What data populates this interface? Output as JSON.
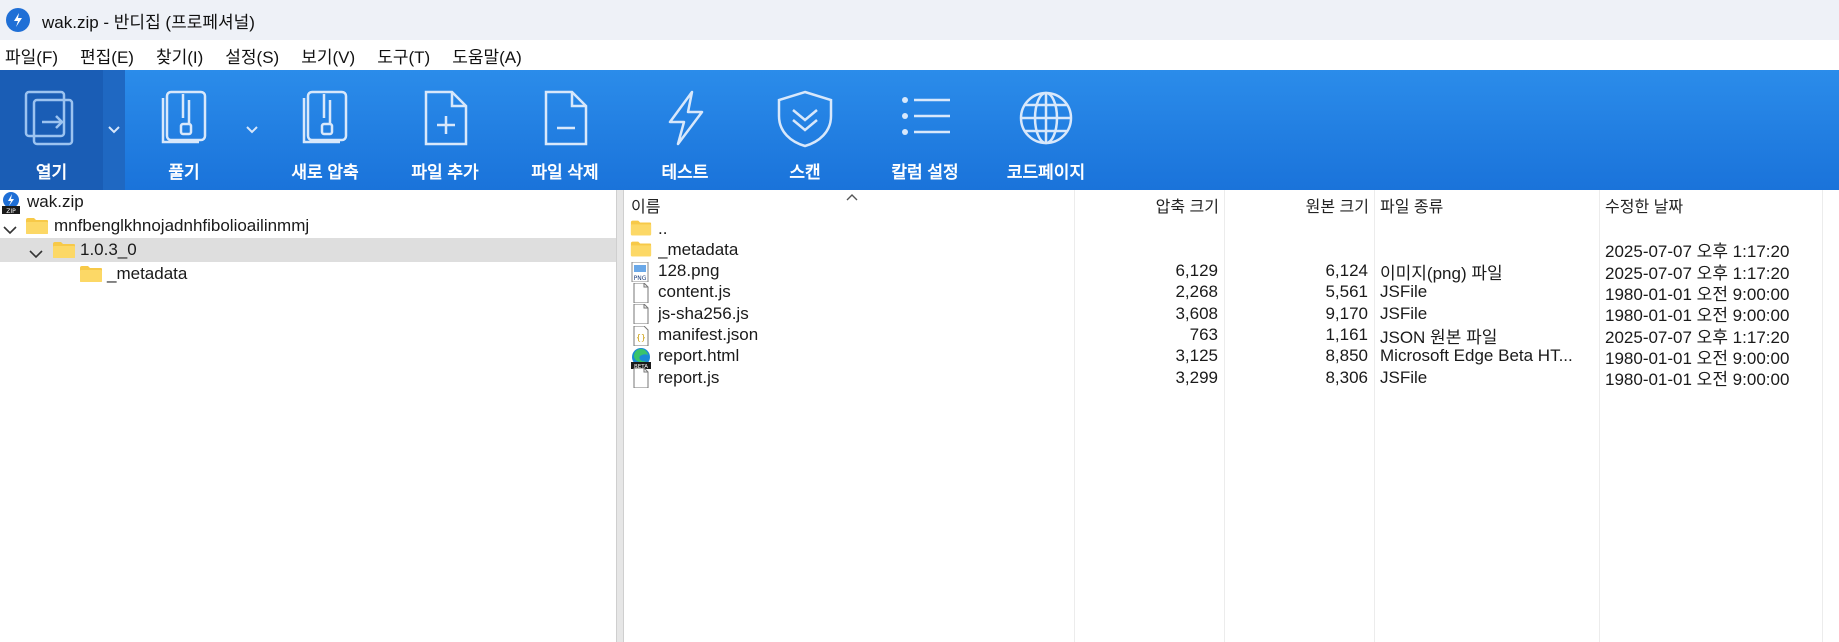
{
  "window": {
    "title": "wak.zip - 반디집 (프로페셔널)"
  },
  "menu": [
    {
      "label": "파일(F)"
    },
    {
      "label": "편집(E)"
    },
    {
      "label": "찾기(I)"
    },
    {
      "label": "설정(S)"
    },
    {
      "label": "보기(V)"
    },
    {
      "label": "도구(T)"
    },
    {
      "label": "도움말(A)"
    }
  ],
  "toolbar": {
    "open": "열기",
    "extract": "풀기",
    "new_archive": "새로 압축",
    "add_files": "파일 추가",
    "delete_files": "파일 삭제",
    "test": "테스트",
    "scan": "스캔",
    "column_settings": "칼럼 설정",
    "codepage": "코드페이지"
  },
  "tree": {
    "root": "wak.zip",
    "level1": "mnfbenglkhnojadnhfibolioailinmmj",
    "level2": "1.0.3_0",
    "level3": "_metadata"
  },
  "columns": {
    "name": "이름",
    "packed_size": "압축 크기",
    "original_size": "원본 크기",
    "file_type": "파일 종류",
    "modified": "수정한 날짜"
  },
  "files": [
    {
      "name": "..",
      "packed": "",
      "size": "",
      "type": "",
      "date": "",
      "icon": "folder-up-icon"
    },
    {
      "name": "_metadata",
      "packed": "",
      "size": "",
      "type": "",
      "date": "2025-07-07 오후 1:17:20",
      "icon": "folder-icon"
    },
    {
      "name": "128.png",
      "packed": "6,129",
      "size": "6,124",
      "type": "이미지(png) 파일",
      "date": "2025-07-07 오후 1:17:20",
      "icon": "png-file-icon"
    },
    {
      "name": "content.js",
      "packed": "2,268",
      "size": "5,561",
      "type": "JSFile",
      "date": "1980-01-01 오전 9:00:00",
      "icon": "file-icon"
    },
    {
      "name": "js-sha256.js",
      "packed": "3,608",
      "size": "9,170",
      "type": "JSFile",
      "date": "1980-01-01 오전 9:00:00",
      "icon": "file-icon"
    },
    {
      "name": "manifest.json",
      "packed": "763",
      "size": "1,161",
      "type": "JSON 원본 파일",
      "date": "2025-07-07 오후 1:17:20",
      "icon": "json-file-icon"
    },
    {
      "name": "report.html",
      "packed": "3,125",
      "size": "8,850",
      "type": "Microsoft Edge Beta HT...",
      "date": "1980-01-01 오전 9:00:00",
      "icon": "edge-beta-icon"
    },
    {
      "name": "report.js",
      "packed": "3,299",
      "size": "8,306",
      "type": "JSFile",
      "date": "1980-01-01 오전 9:00:00",
      "icon": "file-icon"
    }
  ]
}
